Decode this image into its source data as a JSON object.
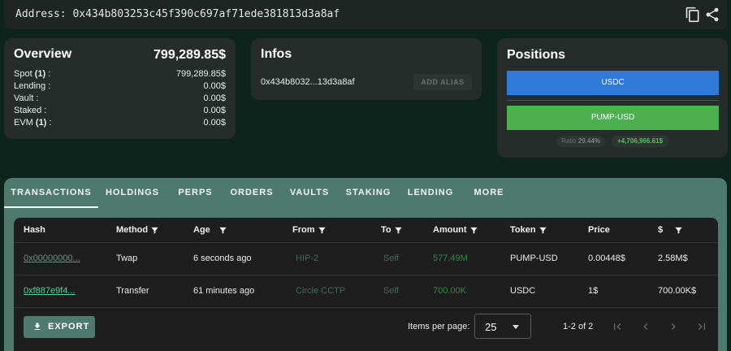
{
  "header": {
    "address_label": "Address:",
    "address": "0x434b803253c45f390c697af71ede381813d3a8af"
  },
  "overview": {
    "title": "Overview",
    "total": "799,289.85$",
    "rows": [
      {
        "label": "Spot",
        "count": "(1)",
        "suffix": ":",
        "value": "799,289.85$"
      },
      {
        "label": "Lending :",
        "value": "0.00$"
      },
      {
        "label": "Vault :",
        "value": "0.00$"
      },
      {
        "label": "Staked :",
        "value": "0.00$"
      },
      {
        "label": "EVM",
        "count": "(1)",
        "suffix": ":",
        "value": "0.00$"
      }
    ]
  },
  "infos": {
    "title": "Infos",
    "short_address": "0x434b8032...13d3a8af",
    "add_alias": "ADD ALIAS"
  },
  "positions": {
    "title": "Positions",
    "items": [
      {
        "label": "USDC",
        "color": "#2f7ad9"
      },
      {
        "label": "PUMP-USD",
        "color": "#4caf50"
      }
    ],
    "ratio_label": "Ratio",
    "ratio_value": "29.44%",
    "pnl": "+4,706,966.61$"
  },
  "tabs": [
    "TRANSACTIONS",
    "HOLDINGS",
    "PERPS",
    "ORDERS",
    "VAULTS",
    "STAKING",
    "LENDING",
    "MORE"
  ],
  "table": {
    "columns": [
      "Hash",
      "Method",
      "Age",
      "From",
      "To",
      "Amount",
      "Token",
      "Price",
      "$"
    ],
    "rows": [
      {
        "hash": "0x00000000...",
        "method": "Twap",
        "age": "6 seconds ago",
        "from": "HIP-2",
        "to": "Self",
        "amount": "577.49M",
        "token": "PUMP-USD",
        "price": "0.00448$",
        "usd": "2.58M$"
      },
      {
        "hash": "0xf887e9f4...",
        "method": "Transfer",
        "age": "61 minutes ago",
        "from": "Circle CCTP",
        "to": "Self",
        "amount": "700.00K",
        "token": "USDC",
        "price": "1$",
        "usd": "700.00K$"
      }
    ]
  },
  "footer": {
    "export": "EXPORT",
    "items_per_page_label": "Items per page:",
    "items_per_page": "25",
    "range": "1-2 of 2"
  },
  "colors": {
    "accent": "#4e7a6d",
    "amount_green": "#2e8b3e",
    "muted_green": "#3f6b5c"
  }
}
